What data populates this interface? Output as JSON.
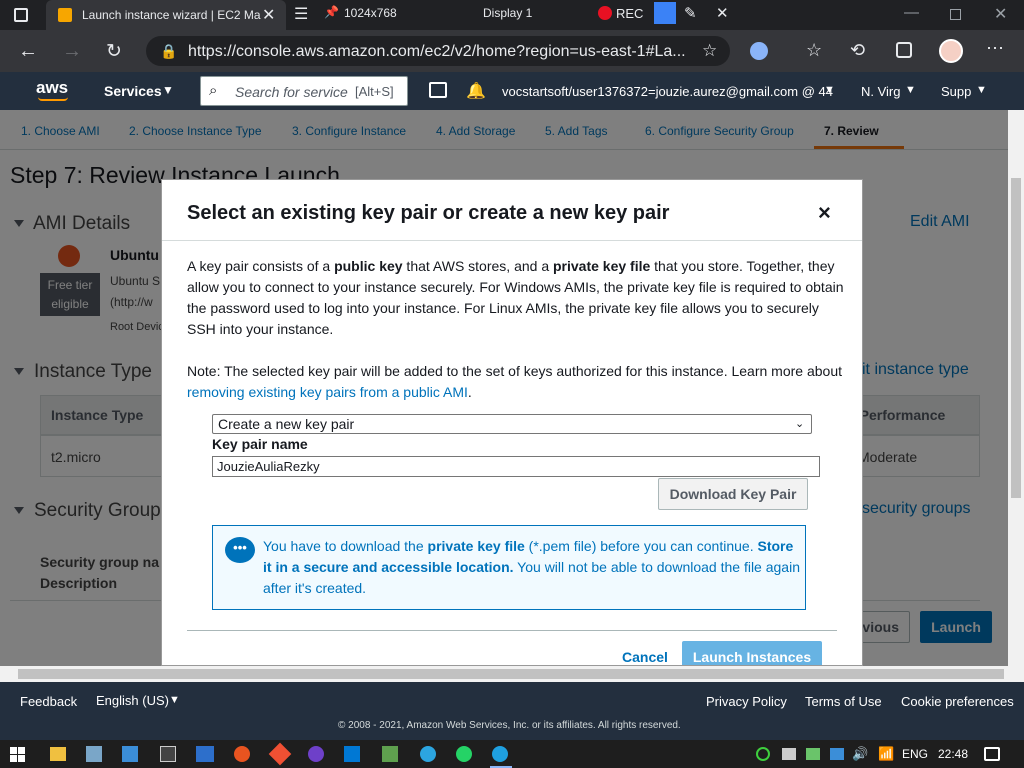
{
  "browser": {
    "tab_title": "Launch instance wizard | EC2 Ma",
    "pinned_tab_label": "1024x768",
    "display_label": "Display 1",
    "rec_label": "REC",
    "url": "https://console.aws.amazon.com/ec2/v2/home?region=us-east-1#La..."
  },
  "awsnav": {
    "logo": "aws",
    "services": "Services",
    "search_placeholder": "Search for service",
    "search_shortcut": "[Alt+S]",
    "account": "vocstartsoft/user1376372=jouzie.aurez@gmail.com @ 44",
    "region": "N. Virg",
    "support": "Supp"
  },
  "steps": [
    "1. Choose AMI",
    "2. Choose Instance Type",
    "3. Configure Instance",
    "4. Add Storage",
    "5. Add Tags",
    "6. Configure Security Group",
    "7. Review"
  ],
  "page": {
    "title": "Step 7: Review Instance Launch",
    "ami_title": "AMI Details",
    "edit_ami": "Edit AMI",
    "ami_name": "Ubuntu",
    "ami_desc1": "Ubuntu S",
    "ami_desc2": "(http://w",
    "root_device": "Root Devic",
    "free_tier1": "Free tier",
    "free_tier2": "eligible",
    "instance_type_title": "Instance Type",
    "edit_instance_type": "it instance type",
    "col_instance_type": "Instance Type",
    "col_performance": "k Performance",
    "instance_value": "t2.micro",
    "performance_value": "Moderate",
    "security_title": "Security Group",
    "edit_security": "security groups",
    "sg_name": "Security group na",
    "sg_desc": "Description",
    "previous": "vious",
    "launch": "Launch"
  },
  "modal": {
    "title": "Select an existing key pair or create a new key pair",
    "close": "×",
    "p1": {
      "a": "A key pair consists of a ",
      "b": "public key",
      "c": " that AWS stores, and a ",
      "d": "private key file",
      "e": " that you store. Together, they allow you to connect to your instance securely. For Windows AMIs, the private key file is required to obtain the password used to log into your instance. For Linux AMIs, the private key file allows you to securely SSH into your instance."
    },
    "p2": {
      "a": "Note: The selected key pair will be added to the set of keys authorized for this instance. Learn more about ",
      "link": "removing existing key pairs from a public AMI",
      "c": "."
    },
    "select_value": "Create a new key pair",
    "kp_label": "Key pair name",
    "kp_value": "JouzieAuliaRezky",
    "download_btn": "Download Key Pair",
    "info": {
      "a": "You have to download the ",
      "b": "private key file",
      "c": " (*.pem file) before you can continue. ",
      "d": "Store it in a secure and accessible location.",
      "e": " You will not be able to download the file again after it's created."
    },
    "cancel": "Cancel",
    "launch_instances": "Launch Instances"
  },
  "footer": {
    "feedback": "Feedback",
    "language": "English (US)",
    "privacy": "Privacy Policy",
    "terms": "Terms of Use",
    "cookie": "Cookie preferences",
    "copyright": "© 2008 - 2021, Amazon Web Services, Inc. or its affiliates. All rights reserved."
  },
  "taskbar": {
    "lang": "ENG",
    "time": "22:48"
  },
  "colors": {
    "aws_nav": "#232f3e",
    "link": "#0073bb",
    "launch": "#0073bb",
    "active_step": "#ec7211",
    "info_border": "#0073bb"
  }
}
